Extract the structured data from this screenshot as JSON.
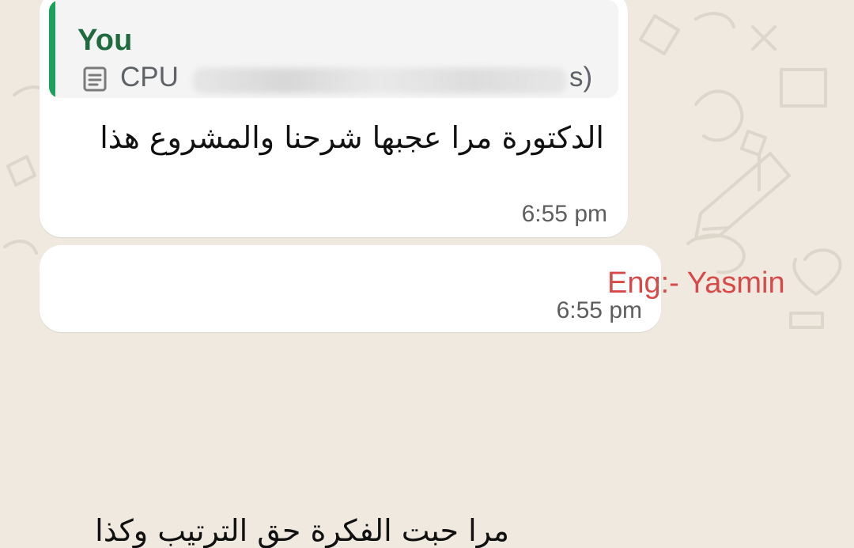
{
  "wallpaper": {
    "color": "#efe9df",
    "pattern": "whatsapp-doodles"
  },
  "messages": [
    {
      "quote": {
        "author": "You",
        "icon": "document-icon",
        "text_start": "CPU",
        "text_end": "s)"
      },
      "text": "الدكتورة مرا عجبها شرحنا والمشروع هذا",
      "time": "6:55 pm"
    },
    {
      "sender": "Eng:- Yasmin",
      "text": "مرا حبت الفكرة حق الترتيب وكذا",
      "time": "6:55 pm"
    }
  ],
  "colors": {
    "bubble": "#ffffff",
    "quote_bar": "#1aa15b",
    "quote_author": "#1f6b3f",
    "sender": "#d84a4a",
    "time": "#5e5e5e"
  }
}
